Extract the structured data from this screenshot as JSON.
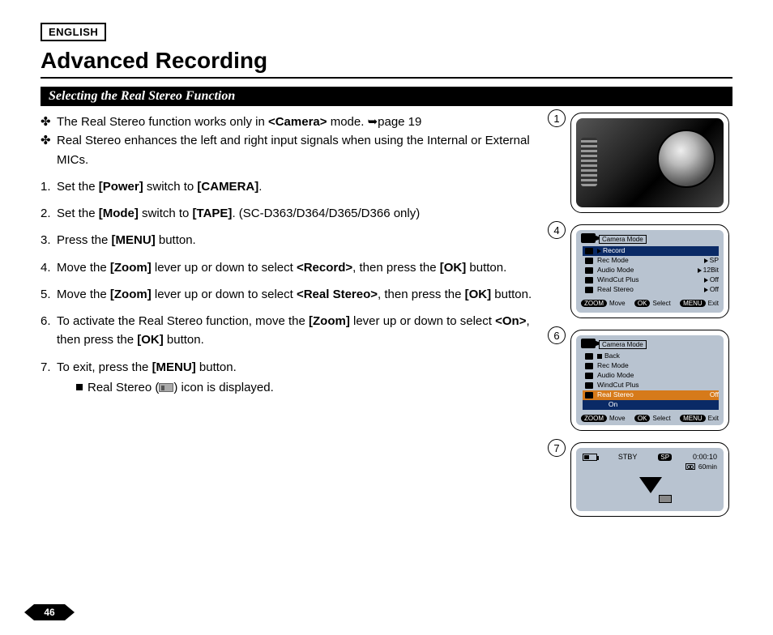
{
  "lang_badge": "ENGLISH",
  "title": "Advanced Recording",
  "section_heading": "Selecting the Real Stereo Function",
  "bullet_char": "✤",
  "notes": [
    {
      "pre": "The Real Stereo function works only in ",
      "bold1": "<Camera>",
      "post1": " mode. ",
      "arrow": "➥",
      "ref": "page 19"
    },
    {
      "text": "Real Stereo enhances the left and right input signals when using the Internal or External MICs."
    }
  ],
  "steps": [
    {
      "n": "1.",
      "parts": [
        "Set the ",
        "[Power]",
        " switch to ",
        "[CAMERA]",
        "."
      ]
    },
    {
      "n": "2.",
      "parts": [
        "Set the ",
        "[Mode]",
        " switch to ",
        "[TAPE]",
        ". (SC-D363/D364/D365/D366 only)"
      ]
    },
    {
      "n": "3.",
      "parts": [
        "Press the ",
        "[MENU]",
        " button."
      ]
    },
    {
      "n": "4.",
      "parts": [
        "Move the ",
        "[Zoom]",
        " lever up or down to select ",
        "<Record>",
        ", then press the ",
        "[OK]",
        " button."
      ]
    },
    {
      "n": "5.",
      "parts": [
        "Move the ",
        "[Zoom]",
        " lever up or down to select ",
        "<Real Stereo>",
        ", then press the ",
        "[OK]",
        " button."
      ]
    },
    {
      "n": "6.",
      "parts": [
        "To activate the Real Stereo function, move the ",
        "[Zoom]",
        " lever up or down to select ",
        "<On>",
        ", then press the ",
        "[OK]",
        " button."
      ]
    },
    {
      "n": "7.",
      "parts": [
        "To exit, press the ",
        "[MENU]",
        " button."
      ]
    }
  ],
  "substep": {
    "pre": "Real Stereo (",
    "post": ") icon is displayed."
  },
  "figures": {
    "f1": {
      "num": "1"
    },
    "f4": {
      "num": "4",
      "title": "Camera Mode",
      "rows": [
        {
          "label": "Record",
          "val": "",
          "hi": true,
          "tri": true
        },
        {
          "label": "Rec Mode",
          "val": "SP"
        },
        {
          "label": "Audio Mode",
          "val": "12Bit"
        },
        {
          "label": "WindCut Plus",
          "val": "Off"
        },
        {
          "label": "Real Stereo",
          "val": "Off"
        }
      ],
      "foot": {
        "zoom": "ZOOM",
        "move": "Move",
        "ok": "OK",
        "select": "Select",
        "menu": "MENU",
        "exit": "Exit"
      }
    },
    "f6": {
      "num": "6",
      "title": "Camera Mode",
      "rows": [
        {
          "label": "Back",
          "sq": true
        },
        {
          "label": "Rec Mode"
        },
        {
          "label": "Audio Mode"
        },
        {
          "label": "WindCut Plus"
        },
        {
          "label": "Real Stereo",
          "val": "Off",
          "hi_orange": true
        },
        {
          "label": "On",
          "check": true,
          "hi": true,
          "indent": true
        }
      ],
      "foot": {
        "zoom": "ZOOM",
        "move": "Move",
        "ok": "OK",
        "select": "Select",
        "menu": "MENU",
        "exit": "Exit"
      }
    },
    "f7": {
      "num": "7",
      "stby": "STBY",
      "sp": "SP",
      "time": "0:00:10",
      "remain": "60min"
    }
  },
  "page_number": "46"
}
